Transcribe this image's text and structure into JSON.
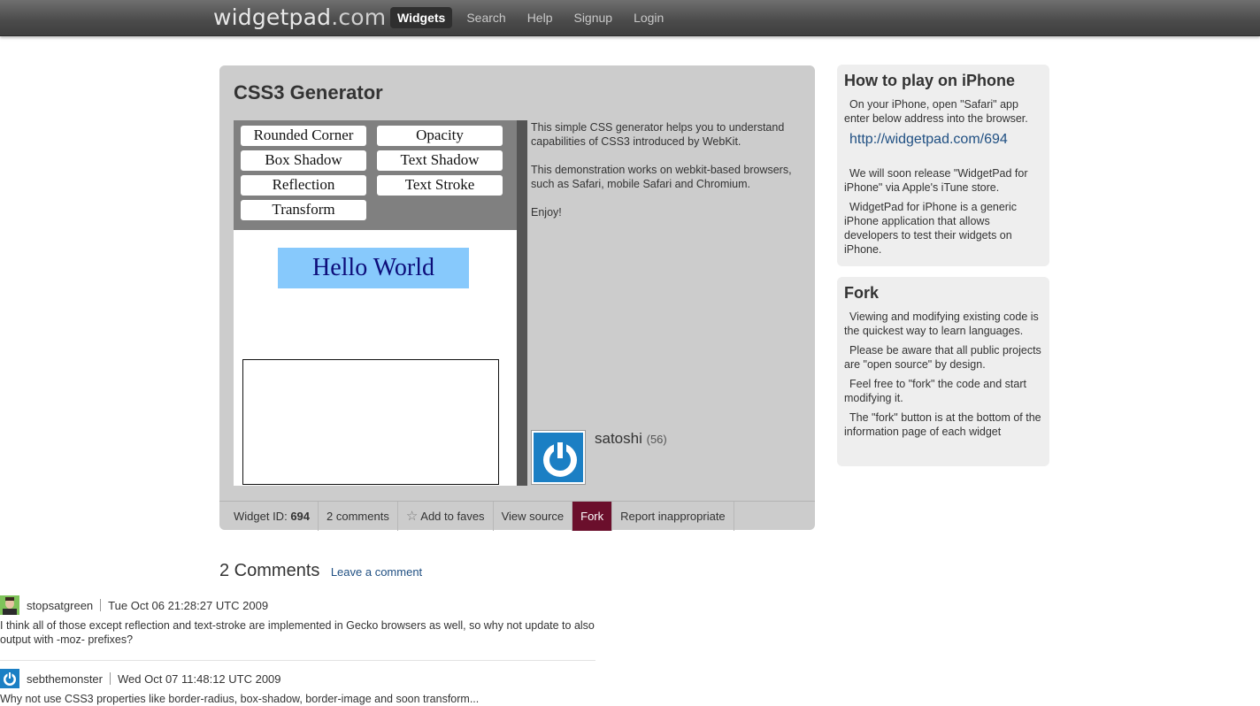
{
  "header": {
    "logo_main": "widgetpad",
    "logo_domain": ".com",
    "nav": [
      "Widgets",
      "Search",
      "Help",
      "Signup",
      "Login"
    ]
  },
  "widget": {
    "title": "CSS3 Generator",
    "buttons": [
      "Rounded Corner",
      "Opacity",
      "Box Shadow",
      "Text Shadow",
      "Reflection",
      "Text Stroke",
      "Transform"
    ],
    "preview_text": "Hello World",
    "description": [
      "This simple CSS generator helps you to understand capabilities of CSS3 introduced by WebKit.",
      "This demonstration works on webkit-based browsers, such as Safari, mobile Safari and Chromium.",
      "Enjoy!"
    ],
    "author": {
      "name": "satoshi",
      "count": "(56)"
    },
    "footer": {
      "widget_id_label": "Widget ID:",
      "widget_id": "694",
      "comments": "2 comments",
      "add_faves": "Add to faves",
      "view_source": "View source",
      "fork": "Fork",
      "report": "Report inappropriate"
    }
  },
  "sidebar": {
    "iphone": {
      "title": "How to play on iPhone",
      "intro": "On your iPhone, open \"Safari\" app enter below address into the browser.",
      "link": "http://widgetpad.com/694",
      "p2": "We will soon release \"WidgetPad for iPhone\" via Apple's iTune store.",
      "p3": "WidgetPad for iPhone is a generic iPhone application that allows developers to test their widgets on iPhone."
    },
    "fork": {
      "title": "Fork",
      "p1": "Viewing and modifying existing code is the quickest way to learn languages.",
      "p2": "Please be aware that all public projects are \"open source\" by design.",
      "p3": "Feel free to \"fork\" the code and start modifying it.",
      "p4": "The \"fork\" button is at the bottom of the information page of each widget"
    }
  },
  "comments": {
    "title": "2 Comments",
    "leave": "Leave a comment",
    "items": [
      {
        "user": "stopsatgreen",
        "date": "Tue Oct 06 21:28:27 UTC 2009",
        "text": "I think all of those except reflection and text-stroke are implemented in Gecko browsers as well, so why not update to also output with -moz- prefixes?"
      },
      {
        "user": "sebthemonster",
        "date": "Wed Oct 07 11:48:12 UTC 2009",
        "text": "Why not use CSS3 properties like border-radius, box-shadow, border-image and soon transform..."
      }
    ]
  }
}
